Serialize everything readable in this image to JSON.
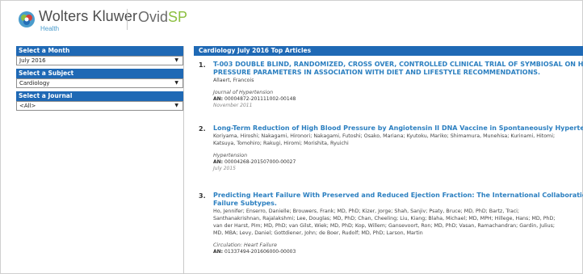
{
  "header": {
    "brand": "Wolters Kluwer",
    "brand_sub": "Health",
    "product_a": "Ovid",
    "product_b": "SP",
    "colors": {
      "brand_blue": "#4a9ccc",
      "product_green": "#8cbf3f"
    }
  },
  "sidebar": {
    "month_label": "Select a Month",
    "month_value": "July 2016",
    "subject_label": "Select a Subject",
    "subject_value": "Cardiology",
    "journal_label": "Select a Journal",
    "journal_value": "<All>",
    "accent": "#1f69b5"
  },
  "main": {
    "title": "Cardiology July 2016 Top Articles",
    "articles": [
      {
        "num": "1.",
        "title_lines": [
          "T-003 DOUBLE BLIND, RANDOMIZED, CROSS OVER, CONTROLLED CLINICAL TRIAL OF SYMBIOSAL ON HIGH BLOOD",
          "PRESSURE PARAMETERS IN ASSOCIATION WITH DIET AND LIFESTYLE RECOMMENDATIONS."
        ],
        "author_lines": [
          "Allaert, Francois"
        ],
        "journal": "Journal of Hypertension",
        "an_label": "AN:",
        "an_value": "00004872-201111002-00148",
        "date": "November 2011"
      },
      {
        "num": "2.",
        "title_lines": [
          "Long-Term Reduction of High Blood Pressure by Angiotensin II DNA Vaccine in Spontaneously Hypertensive Rats"
        ],
        "author_lines": [
          "Koriyama, Hiroshi; Nakagami, Hironori; Nakagami, Futoshi; Osako, Mariana; Kyutoku, Mariko; Shimamura, Munehisa; Kurinami, Hitomi;",
          "Katsuya, Tomohiro; Rakugi, Hiromi; Morishita, Ryuichi"
        ],
        "journal": "Hypertension",
        "an_label": "AN:",
        "an_value": "00004268-201507000-00027",
        "date": "July 2015"
      },
      {
        "num": "3.",
        "title_lines": [
          "Predicting Heart Failure With Preserved and Reduced Ejection Fraction: The International Collaboration on Heart",
          "Failure Subtypes."
        ],
        "author_lines": [
          "Ho, Jennifer; Enserro, Danielle; Brouwers, Frank; MD, PhD; Kizer, Jorge; Shah, Sanjiv; Psaty, Bruce; MD, PhD; Bartz, Traci;",
          "Santhanakrishnan, Rajalakshmi; Lee, Douglas; MD, PhD; Chan, Cheeling; Liu, Kiang; Blaha, Michael; MD, MPH; Hillege, Hans; MD, PhD;",
          "van der Harst, Pim; MD, PhD; van Gilst, Wiek; MD, PhD; Kop, Willem; Gansevoort, Ron; MD, PhD; Vasan, Ramachandran; Gardin, Julius;",
          "MD, MBA; Levy, Daniel; Gottdiener, John; de Boer, Rudolf; MD, PhD; Larson, Martin"
        ],
        "journal": "Circulation: Heart Failure",
        "an_label": "AN:",
        "an_value": "01337494-201606000-00003",
        "date": ""
      }
    ]
  }
}
